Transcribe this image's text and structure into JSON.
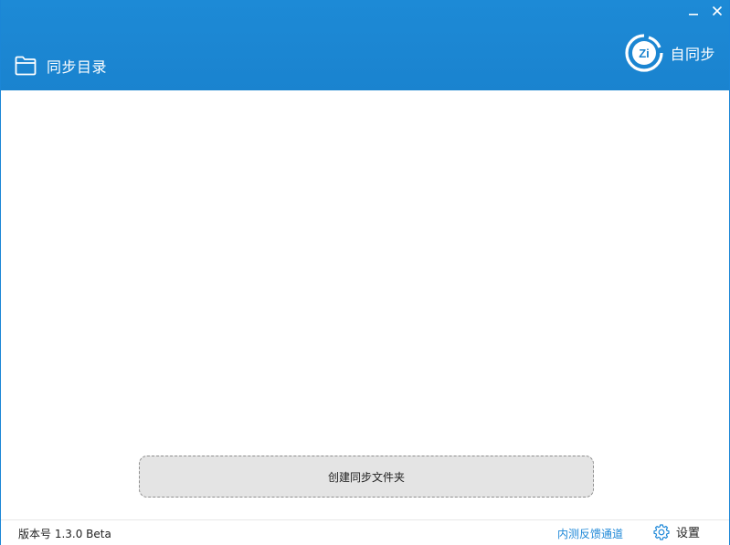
{
  "header": {
    "title": "同步目录",
    "brand_name": "自同步",
    "logo_text": "Zi",
    "accent_color": "#1a83cf"
  },
  "window_controls": {
    "minimize_icon": "minimize-icon",
    "close_icon": "close-icon"
  },
  "main": {
    "create_button_label": "创建同步文件夹"
  },
  "footer": {
    "version": "版本号 1.3.0 Beta",
    "feedback_label": "内测反馈通道",
    "feedback_color": "#1e88d8",
    "settings_label": "设置"
  }
}
